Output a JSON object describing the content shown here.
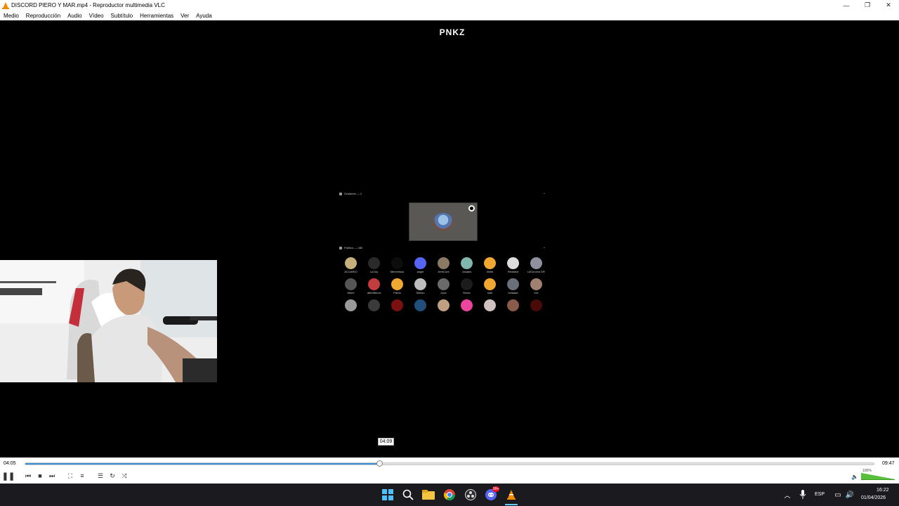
{
  "window": {
    "title": "DISCORD PIERO Y MAR.mp4 - Reproductor multimedia VLC",
    "minimize_glyph": "—",
    "maximize_glyph": "❐",
    "close_glyph": "✕"
  },
  "menu": [
    "Medio",
    "Reproducción",
    "Audio",
    "Vídeo",
    "Subtítulo",
    "Herramientas",
    "Ver",
    "Ayuda"
  ],
  "video": {
    "logo_text": "PNKZ",
    "discord": {
      "speakers_header": "Oradores — 1",
      "audience_header": "Público — 280",
      "audience": [
        [
          {
            "name": "ACUARIO",
            "color": "#c5b07a"
          },
          {
            "name": "LuCky",
            "color": "#2a2a2a"
          },
          {
            "name": "Memerisus",
            "color": "#0d0d0d"
          },
          {
            "name": "angel",
            "color": "#5865f2"
          },
          {
            "name": "JereCore",
            "color": "#8a7a63"
          },
          {
            "name": "Josadio",
            "color": "#7fb7ae"
          },
          {
            "name": "Illnkb",
            "color": "#f0a830"
          },
          {
            "name": "Redaled",
            "color": "#dcdcdc"
          },
          {
            "name": "LilGoncho DR",
            "color": "#8f8fa0"
          }
        ],
        [
          {
            "name": "Mümi",
            "color": "#555"
          },
          {
            "name": "alfredfdora",
            "color": "#c23d3d"
          },
          {
            "name": "Pardo",
            "color": "#f0a830"
          },
          {
            "name": "Skinsu",
            "color": "#bdbdbd"
          },
          {
            "name": "Zyzz",
            "color": "#6a6a6a"
          },
          {
            "name": "Rubio",
            "color": "#1c1c1c"
          },
          {
            "name": "sofii",
            "color": "#f0a830"
          },
          {
            "name": "bolaaaa",
            "color": "#6b6f7a"
          },
          {
            "name": "ezz",
            "color": "#a08070"
          }
        ],
        [
          {
            "name": "",
            "color": "#9a9a9a"
          },
          {
            "name": "",
            "color": "#3a3a3a"
          },
          {
            "name": "",
            "color": "#7a1010"
          },
          {
            "name": "",
            "color": "#1f4f7a"
          },
          {
            "name": "",
            "color": "#c0a080"
          },
          {
            "name": "",
            "color": "#eb459e"
          },
          {
            "name": "",
            "color": "#d0c0c0"
          },
          {
            "name": "",
            "color": "#8a5a4a"
          },
          {
            "name": "",
            "color": "#4a0a0a"
          }
        ]
      ]
    },
    "hover_time": "04:09"
  },
  "controls": {
    "elapsed": "04:05",
    "total": "09:47",
    "progress": 0.417,
    "volume_label": "100%"
  },
  "taskbar": {
    "language": "ESP",
    "time": "16:22",
    "date": "01/04/2026",
    "discord_badge": "99+"
  },
  "colors": {
    "accent": "#3a8fd6",
    "volume": "#58c03a",
    "vlc": "#f28a00",
    "taskbar": "#1b1b1f"
  }
}
